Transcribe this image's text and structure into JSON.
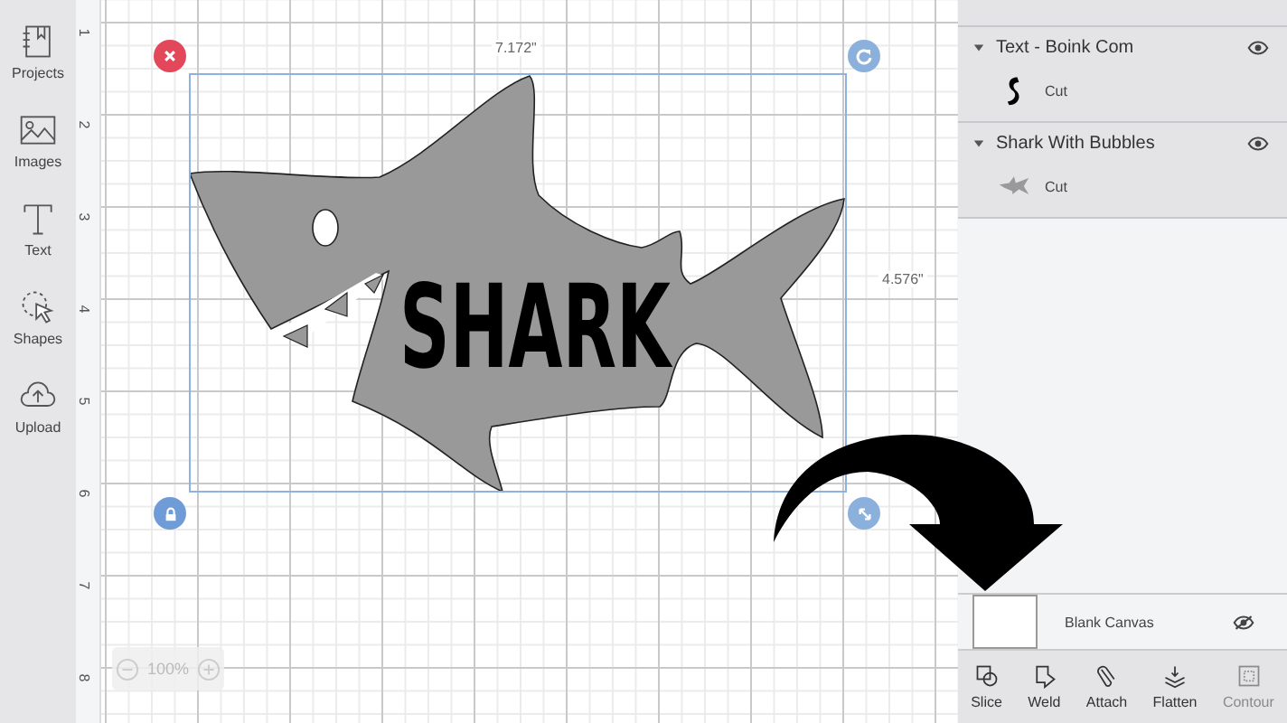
{
  "sidebar": {
    "items": [
      {
        "label": "Projects",
        "kind": "projects"
      },
      {
        "label": "Images",
        "kind": "images"
      },
      {
        "label": "Text",
        "kind": "text"
      },
      {
        "label": "Shapes",
        "kind": "shapes"
      },
      {
        "label": "Upload",
        "kind": "upload"
      }
    ]
  },
  "canvas": {
    "ruler_marks": [
      "1",
      "2",
      "3",
      "4",
      "5",
      "6",
      "7",
      "8"
    ],
    "design": {
      "text": "SHARK",
      "width_label": "7.172\"",
      "height_label": "4.576\""
    },
    "zoom": {
      "value": "100%"
    }
  },
  "layers": [
    {
      "name": "Text - Boink Com",
      "expanded": true,
      "visible": true,
      "children": [
        {
          "label": "Cut",
          "kind": "letter"
        }
      ]
    },
    {
      "name": "Shark With Bubbles",
      "expanded": true,
      "visible": true,
      "children": [
        {
          "label": "Cut",
          "kind": "shark"
        }
      ]
    }
  ],
  "blank_canvas": {
    "label": "Blank Canvas",
    "visible": false
  },
  "toolbar": [
    {
      "label": "Slice",
      "kind": "slice",
      "disabled": false
    },
    {
      "label": "Weld",
      "kind": "weld",
      "disabled": false
    },
    {
      "label": "Attach",
      "kind": "attach",
      "disabled": false
    },
    {
      "label": "Flatten",
      "kind": "flatten",
      "disabled": false
    },
    {
      "label": "Contour",
      "kind": "contour",
      "disabled": true
    }
  ]
}
